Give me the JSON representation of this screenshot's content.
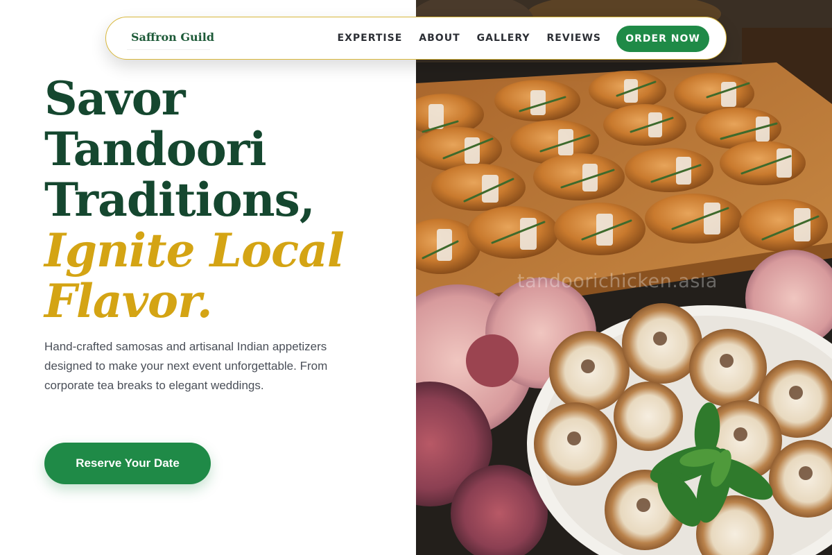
{
  "nav": {
    "brand": "Saffron Guild",
    "links": [
      "EXPERTISE",
      "ABOUT",
      "GALLERY",
      "REVIEWS"
    ],
    "order_label": "ORDER NOW"
  },
  "hero": {
    "headline_dark": [
      "Savor",
      "Tandoori",
      "Traditions,"
    ],
    "headline_gold": [
      "Ignite Local",
      "Flavor."
    ],
    "lede": "Hand-crafted samosas and artisanal Indian appetizers designed to make your next event unforgettable. From corporate tea breaks to elegant weddings.",
    "cta_label": "Reserve Your Date"
  },
  "photo": {
    "watermark": "tandoorichicken.asia"
  },
  "colors": {
    "brand_green": "#1f8a47",
    "headline_green": "#15472f",
    "accent_gold": "#d4a414",
    "nav_border": "#d8b73a"
  }
}
